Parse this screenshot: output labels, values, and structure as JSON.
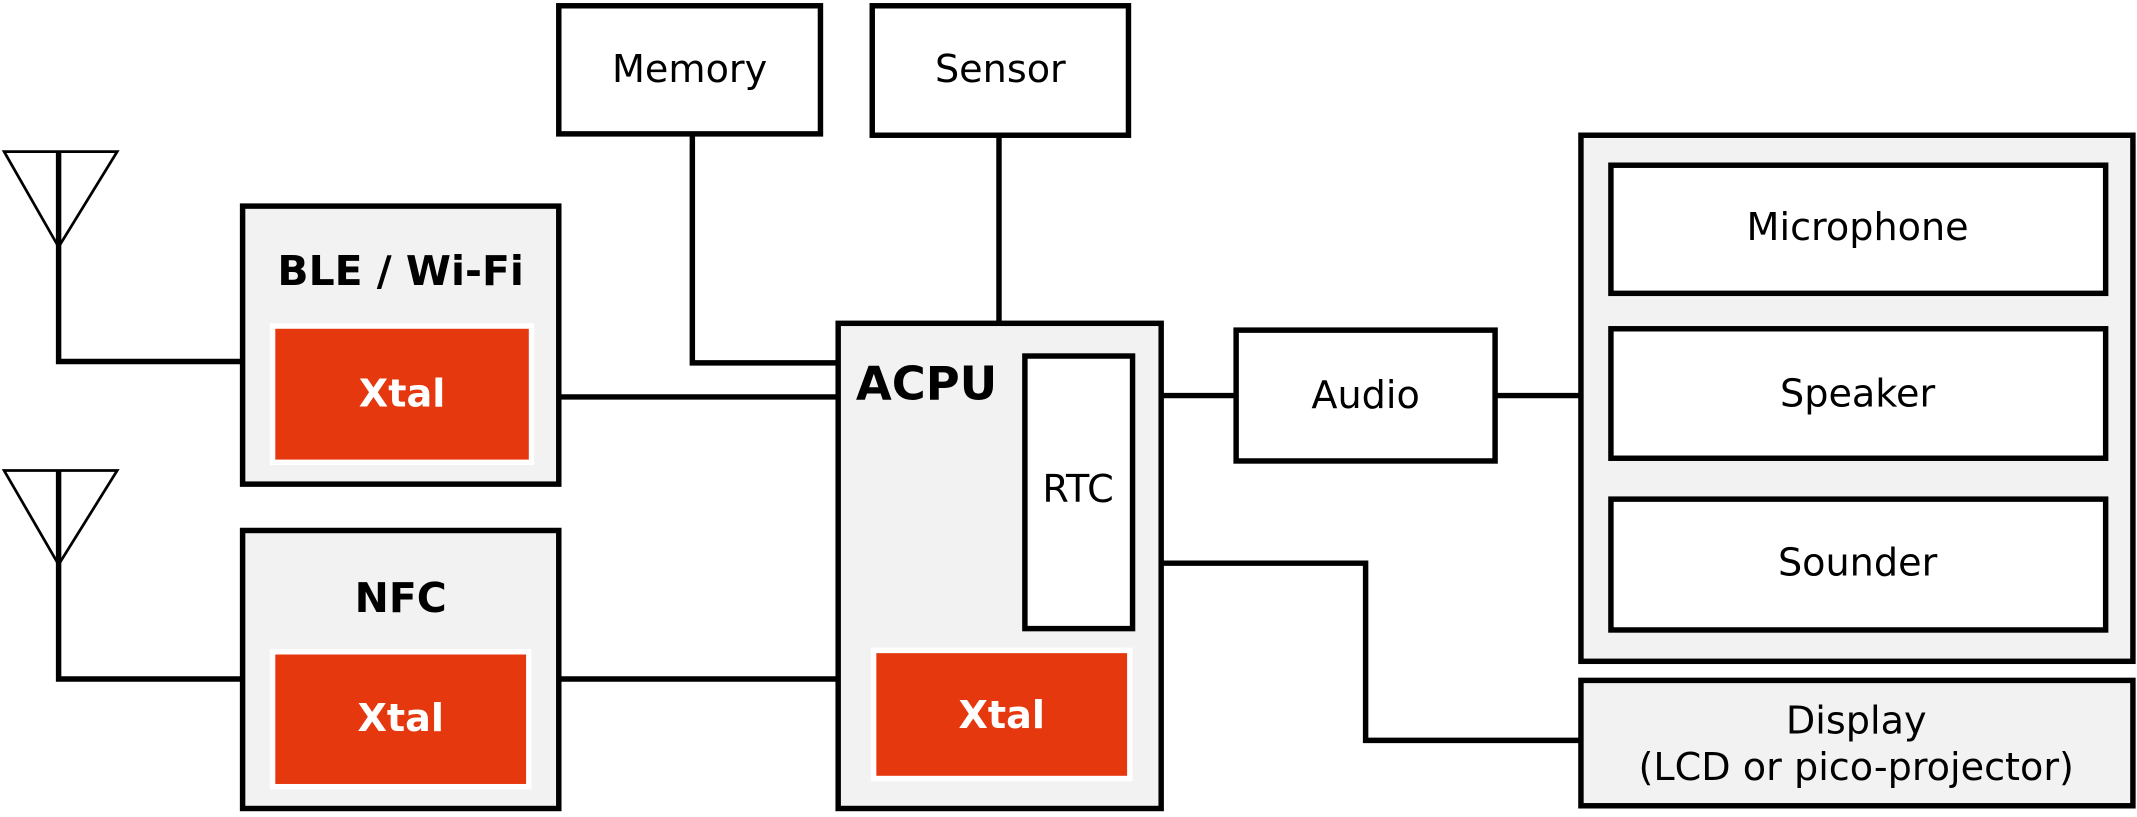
{
  "diagram": {
    "blocks": {
      "memory": "Memory",
      "sensor": "Sensor",
      "ble_wifi": "BLE / Wi-Fi",
      "nfc": "NFC",
      "acpu": "ACPU",
      "rtc": "RTC",
      "xtal": "Xtal",
      "audio": "Audio",
      "microphone": "Microphone",
      "speaker": "Speaker",
      "sounder": "Sounder",
      "display_line1": "Display",
      "display_line2": "(LCD or pico-projector)"
    },
    "colors": {
      "xtal": "#e5380f",
      "block_fill": "#f2f2f2",
      "line": "#000000"
    }
  }
}
